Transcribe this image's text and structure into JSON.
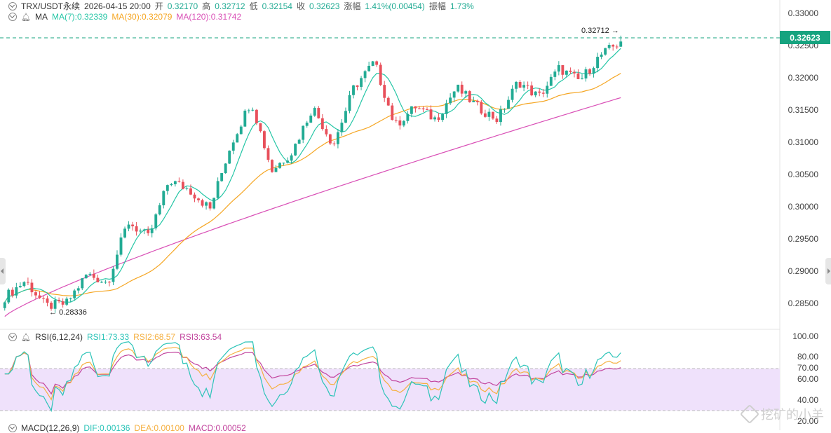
{
  "header": {
    "symbol": "TRX/USDT永续",
    "datetime": "2026-04-15 20:00",
    "open_label": "开",
    "open": "0.32170",
    "high_label": "高",
    "high": "0.32712",
    "low_label": "低",
    "low": "0.32154",
    "close_label": "收",
    "close": "0.32623",
    "change_label": "涨幅",
    "change": "1.41%(0.00454)",
    "amp_label": "振幅",
    "amp": "1.73%"
  },
  "ma_legend": {
    "label": "MA",
    "ma7": "MA(7):0.32339",
    "ma30": "MA(30):0.32079",
    "ma120": "MA(120):0.31742"
  },
  "rsi_legend": {
    "label": "RSI(6,12,24)",
    "rsi1": "RSI1:73.33",
    "rsi2": "RSI2:68.57",
    "rsi3": "RSI3:63.54"
  },
  "macd_legend": {
    "label": "MACD(12,26,9)",
    "dif": "DIF:0.00136",
    "dea": "DEA:0.00100",
    "macd": "MACD:0.00052"
  },
  "annotations": {
    "high_marker": "0.32712",
    "low_marker": "0.28336",
    "current_price": "0.32623"
  },
  "price_axis": [
    "0.33000",
    "0.32500",
    "0.32000",
    "0.31500",
    "0.31000",
    "0.30500",
    "0.30000",
    "0.29500",
    "0.29000",
    "0.28500"
  ],
  "rsi_axis": [
    "100.00",
    "80.00",
    "70.00",
    "60.00",
    "40.00",
    "20.00"
  ],
  "watermark": "挖矿的小羊",
  "colors": {
    "up": "#22ab94",
    "down": "#e8505b",
    "ma7": "#26c6a6",
    "ma30": "#f5a623",
    "ma120": "#d94fb6",
    "rsi1": "#2bc4b8",
    "rsi2": "#f5b041",
    "rsi3": "#c2459e",
    "rsi_band": "#efe1fb"
  },
  "chart_data": {
    "type": "candlestick",
    "y_range": [
      0.2825,
      0.3305
    ],
    "last_price": 0.32623,
    "period_high": 0.32712,
    "period_low": 0.28336,
    "ohlc_sample": [
      {
        "o": 0.2845,
        "h": 0.287,
        "l": 0.2838,
        "c": 0.2862
      },
      {
        "o": 0.286,
        "h": 0.2895,
        "l": 0.285,
        "c": 0.2888
      },
      {
        "o": 0.2888,
        "h": 0.2905,
        "l": 0.284,
        "c": 0.2848
      },
      {
        "o": 0.2848,
        "h": 0.2858,
        "l": 0.28336,
        "c": 0.2852
      },
      {
        "o": 0.2852,
        "h": 0.2902,
        "l": 0.2848,
        "c": 0.2898
      },
      {
        "o": 0.2898,
        "h": 0.292,
        "l": 0.288,
        "c": 0.2885
      },
      {
        "o": 0.2885,
        "h": 0.299,
        "l": 0.288,
        "c": 0.298
      },
      {
        "o": 0.298,
        "h": 0.2995,
        "l": 0.295,
        "c": 0.2955
      },
      {
        "o": 0.2955,
        "h": 0.305,
        "l": 0.295,
        "c": 0.3045
      },
      {
        "o": 0.3045,
        "h": 0.3092,
        "l": 0.302,
        "c": 0.303
      },
      {
        "o": 0.303,
        "h": 0.3045,
        "l": 0.299,
        "c": 0.3
      },
      {
        "o": 0.3,
        "h": 0.311,
        "l": 0.2995,
        "c": 0.31
      },
      {
        "o": 0.31,
        "h": 0.319,
        "l": 0.308,
        "c": 0.317
      },
      {
        "o": 0.317,
        "h": 0.3185,
        "l": 0.305,
        "c": 0.306
      },
      {
        "o": 0.306,
        "h": 0.31,
        "l": 0.3035,
        "c": 0.309
      },
      {
        "o": 0.309,
        "h": 0.317,
        "l": 0.308,
        "c": 0.316
      },
      {
        "o": 0.316,
        "h": 0.317,
        "l": 0.309,
        "c": 0.31
      },
      {
        "o": 0.31,
        "h": 0.32,
        "l": 0.3095,
        "c": 0.319
      },
      {
        "o": 0.319,
        "h": 0.3245,
        "l": 0.317,
        "c": 0.323
      },
      {
        "o": 0.323,
        "h": 0.324,
        "l": 0.311,
        "c": 0.313
      },
      {
        "o": 0.313,
        "h": 0.317,
        "l": 0.311,
        "c": 0.316
      },
      {
        "o": 0.316,
        "h": 0.3165,
        "l": 0.313,
        "c": 0.314
      },
      {
        "o": 0.314,
        "h": 0.3195,
        "l": 0.3135,
        "c": 0.319
      },
      {
        "o": 0.319,
        "h": 0.3195,
        "l": 0.315,
        "c": 0.316
      },
      {
        "o": 0.316,
        "h": 0.3165,
        "l": 0.313,
        "c": 0.314
      },
      {
        "o": 0.314,
        "h": 0.3205,
        "l": 0.3135,
        "c": 0.32
      },
      {
        "o": 0.32,
        "h": 0.321,
        "l": 0.3165,
        "c": 0.3175
      },
      {
        "o": 0.3175,
        "h": 0.3225,
        "l": 0.317,
        "c": 0.322
      },
      {
        "o": 0.322,
        "h": 0.323,
        "l": 0.319,
        "c": 0.32
      },
      {
        "o": 0.32,
        "h": 0.3245,
        "l": 0.3195,
        "c": 0.324
      },
      {
        "o": 0.324,
        "h": 0.3271,
        "l": 0.3215,
        "c": 0.3262
      }
    ],
    "rsi_range": [
      0,
      100
    ]
  }
}
